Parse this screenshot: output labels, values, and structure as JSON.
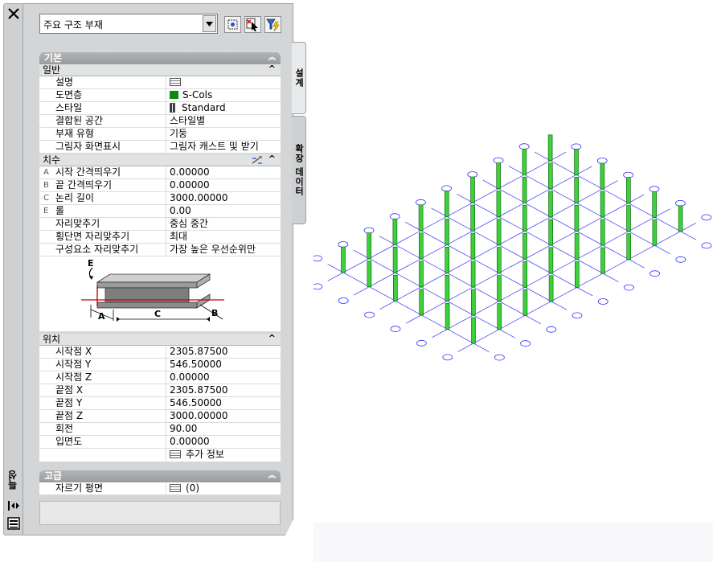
{
  "left_strip": {
    "properties_label": "특성"
  },
  "right_tabs": {
    "design": "설계",
    "extended_data": "확장 데이터"
  },
  "style_dropdown": {
    "value": "주요 구조 부재"
  },
  "sections": {
    "basic": {
      "title": "기본",
      "general": {
        "title": "일반",
        "rows": [
          {
            "label": "설명",
            "value": ""
          },
          {
            "label": "도면층",
            "value": "S-Cols"
          },
          {
            "label": "스타일",
            "value": "Standard"
          },
          {
            "label": "결합된 공간",
            "value": "스타일별"
          },
          {
            "label": "부재 유형",
            "value": "기둥"
          },
          {
            "label": "그림자 화면표시",
            "value": "그림자 캐스트 및 받기"
          }
        ]
      },
      "dimensions": {
        "title": "치수",
        "rows": [
          {
            "letter": "A",
            "label": "시작 간격띄우기",
            "value": "0.00000"
          },
          {
            "letter": "B",
            "label": "끝 간격띄우기",
            "value": "0.00000"
          },
          {
            "letter": "C",
            "label": "논리 길이",
            "value": "3000.00000"
          },
          {
            "letter": "E",
            "label": "롤",
            "value": "0.00"
          },
          {
            "letter": "",
            "label": "자리맞추기",
            "value": "중심 중간"
          },
          {
            "letter": "",
            "label": "횡단면 자리맞추기",
            "value": "최대"
          },
          {
            "letter": "",
            "label": "구성요소 자리맞추기",
            "value": "가장 높은 우선순위만"
          }
        ],
        "diagram_labels": {
          "a": "A",
          "b": "B",
          "c": "C",
          "e": "E"
        }
      },
      "location": {
        "title": "위치",
        "rows": [
          {
            "label": "시작점 X",
            "value": "2305.87500"
          },
          {
            "label": "시작점 Y",
            "value": "546.50000"
          },
          {
            "label": "시작점 Z",
            "value": "0.00000"
          },
          {
            "label": "끝점 X",
            "value": "2305.87500"
          },
          {
            "label": "끝점 Y",
            "value": "546.50000"
          },
          {
            "label": "끝점 Z",
            "value": "3000.00000"
          },
          {
            "label": "회전",
            "value": "90.00"
          },
          {
            "label": "입면도",
            "value": "0.00000"
          }
        ],
        "more_info": "추가 정보"
      }
    },
    "advanced": {
      "title": "고급",
      "rows": [
        {
          "label": "자르기 평면",
          "value": "(0)"
        }
      ]
    }
  },
  "colors": {
    "layer_swatch": "#0a8a0a",
    "column_green": "#3ad13a",
    "grid_blue": "#3333ff",
    "header_gray": "#a6a7a9"
  }
}
